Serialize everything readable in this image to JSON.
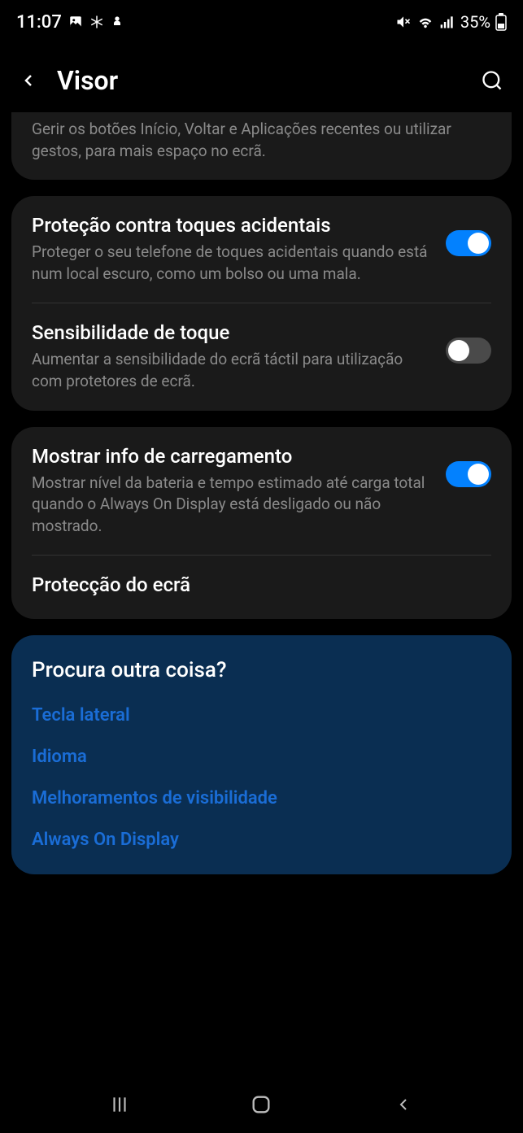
{
  "status": {
    "time": "11:07",
    "battery": "35%"
  },
  "header": {
    "title": "Visor"
  },
  "partial_card": {
    "desc": "Gerir os botões Início, Voltar e Aplicações recentes ou utilizar gestos, para mais espaço no ecrã."
  },
  "card1": {
    "item1": {
      "title": "Proteção contra toques acidentais",
      "desc": "Proteger o seu telefone de toques acidentais quando está num local escuro, como um bolso ou uma mala.",
      "toggle": true
    },
    "item2": {
      "title": "Sensibilidade de toque",
      "desc": "Aumentar a sensibilidade do ecrã táctil para utilização com protetores de ecrã.",
      "toggle": false
    }
  },
  "card2": {
    "item1": {
      "title": "Mostrar info de carregamento",
      "desc": "Mostrar nível da bateria e tempo estimado até carga total quando o Always On Display está desligado ou não mostrado.",
      "toggle": true
    },
    "item2": {
      "title": "Protecção do ecrã"
    }
  },
  "suggestions": {
    "title": "Procura outra coisa?",
    "links": {
      "link1": "Tecla lateral",
      "link2": "Idioma",
      "link3": "Melhoramentos de visibilidade",
      "link4": "Always On Display"
    }
  }
}
